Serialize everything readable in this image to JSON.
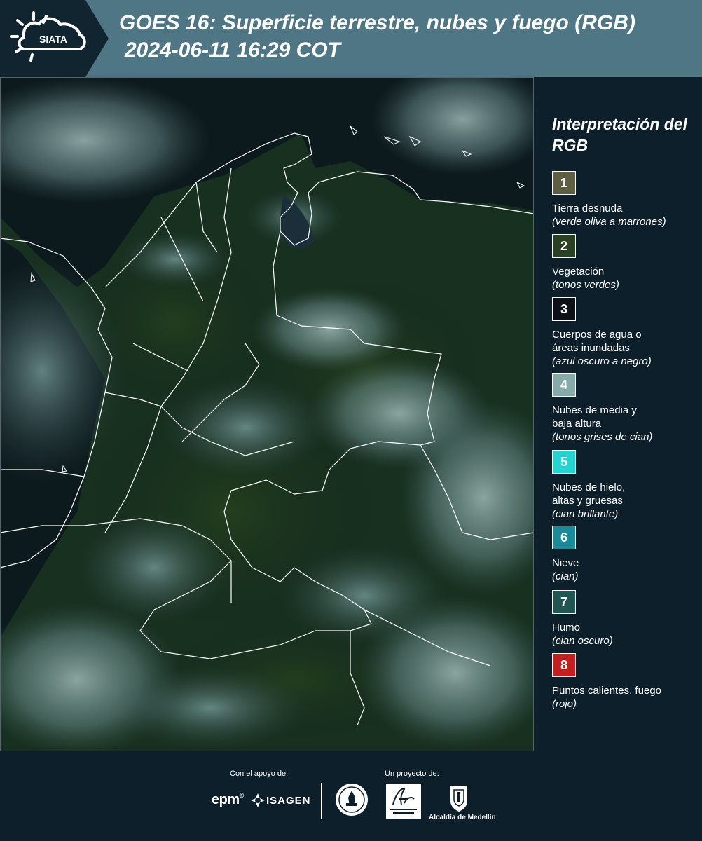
{
  "header": {
    "logo_text": "SIATA",
    "title_line1": "GOES 16: Superficie terrestre, nubes y fuego (RGB)",
    "title_line2": "2024-06-11 16:29 COT"
  },
  "legend": {
    "title": "Interpretación del RGB",
    "items": [
      {
        "number": "1",
        "label": "Tierra desnuda",
        "desc": "(verde oliva a marrones)",
        "color": "#5e5e43"
      },
      {
        "number": "2",
        "label": "Vegetación",
        "desc": "(tonos verdes)",
        "color": "#2a4022"
      },
      {
        "number": "3",
        "label": "Cuerpos de agua o áreas inundadas",
        "desc": "(azul oscuro a negro)",
        "color": "#0b1116"
      },
      {
        "number": "4",
        "label": "Nubes de media y baja altura",
        "desc": "(tonos grises de cian)",
        "color": "#86aaa9"
      },
      {
        "number": "5",
        "label": "Nubes de hielo, altas y gruesas",
        "desc": "(cian brillante)",
        "color": "#25d3d2"
      },
      {
        "number": "6",
        "label": "Nieve",
        "desc": "(cian)",
        "color": "#1a8a9a"
      },
      {
        "number": "7",
        "label": "Humo",
        "desc": "(cian oscuro)",
        "color": "#215554"
      },
      {
        "number": "8",
        "label": "Puntos calientes, fuego",
        "desc": "(rojo)",
        "color": "#c1201e"
      }
    ]
  },
  "footer": {
    "support_label": "Con el apoyo de:",
    "project_label": "Un proyecto de:",
    "epm": "epm",
    "isagen": "ISAGEN",
    "alcaldia": "Alcaldía de Medellín"
  },
  "map": {
    "image": "satellite-rgb-colombia"
  }
}
